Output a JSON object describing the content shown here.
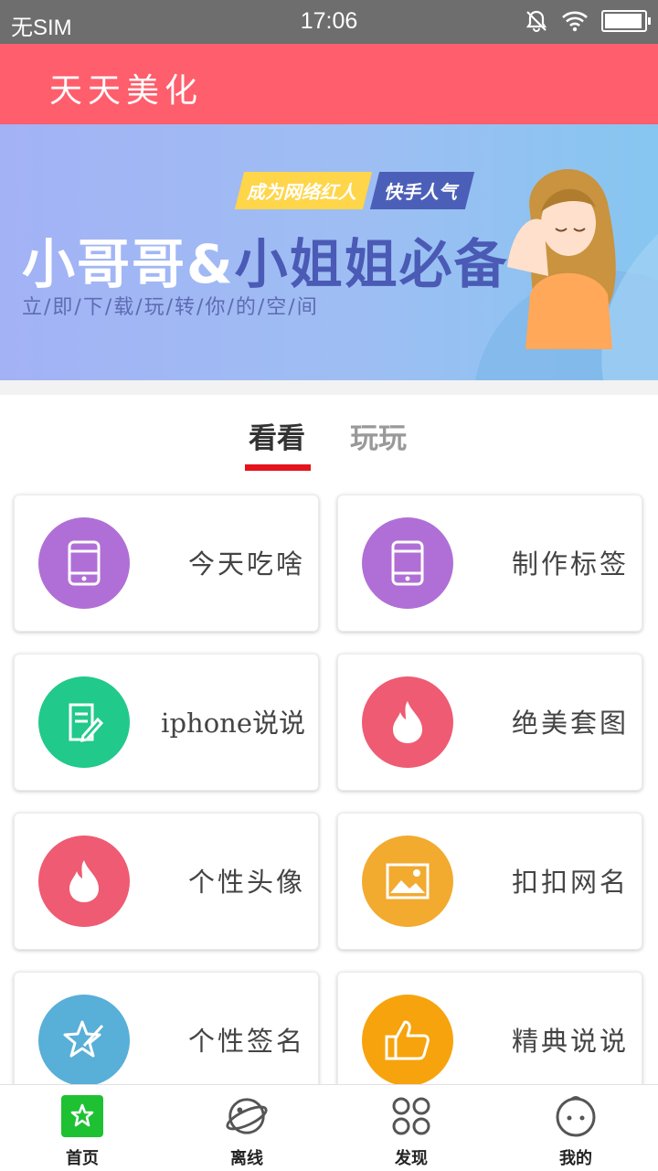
{
  "status_bar": {
    "carrier": "无SIM",
    "time": "17:06",
    "battery_level": 0.95
  },
  "app_bar": {
    "title": "天天美化"
  },
  "banner": {
    "tag_left": "成为网络红人",
    "tag_right": "快手人气",
    "headline_light": "小哥哥&",
    "headline_dark": "小姐姐必备",
    "subline": "立/即/下/载/玩/转/你/的/空/间"
  },
  "tabs": {
    "active": "看看",
    "inactive": "玩玩"
  },
  "cards": [
    {
      "label": "今天吃啥",
      "icon": "phone-icon",
      "color": "#b06fd6"
    },
    {
      "label": "制作标签",
      "icon": "phone-icon",
      "color": "#b06fd6"
    },
    {
      "label": "iphone说说",
      "icon": "edit-note-icon",
      "color": "#21c98b"
    },
    {
      "label": "绝美套图",
      "icon": "flame-icon",
      "color": "#ee5b72"
    },
    {
      "label": "个性头像",
      "icon": "flame-icon",
      "color": "#ee5b72"
    },
    {
      "label": "扣扣网名",
      "icon": "image-icon",
      "color": "#f2aa2f"
    },
    {
      "label": "个性签名",
      "icon": "star-pen-icon",
      "color": "#58afd8"
    },
    {
      "label": "精典说说",
      "icon": "thumbs-up-icon",
      "color": "#f7a30d"
    }
  ],
  "nav": [
    {
      "label": "首页",
      "icon": "home-star-icon",
      "active_color": "#1ec132"
    },
    {
      "label": "离线",
      "icon": "planet-icon"
    },
    {
      "label": "发现",
      "icon": "four-circles-icon"
    },
    {
      "label": "我的",
      "icon": "face-icon"
    }
  ]
}
